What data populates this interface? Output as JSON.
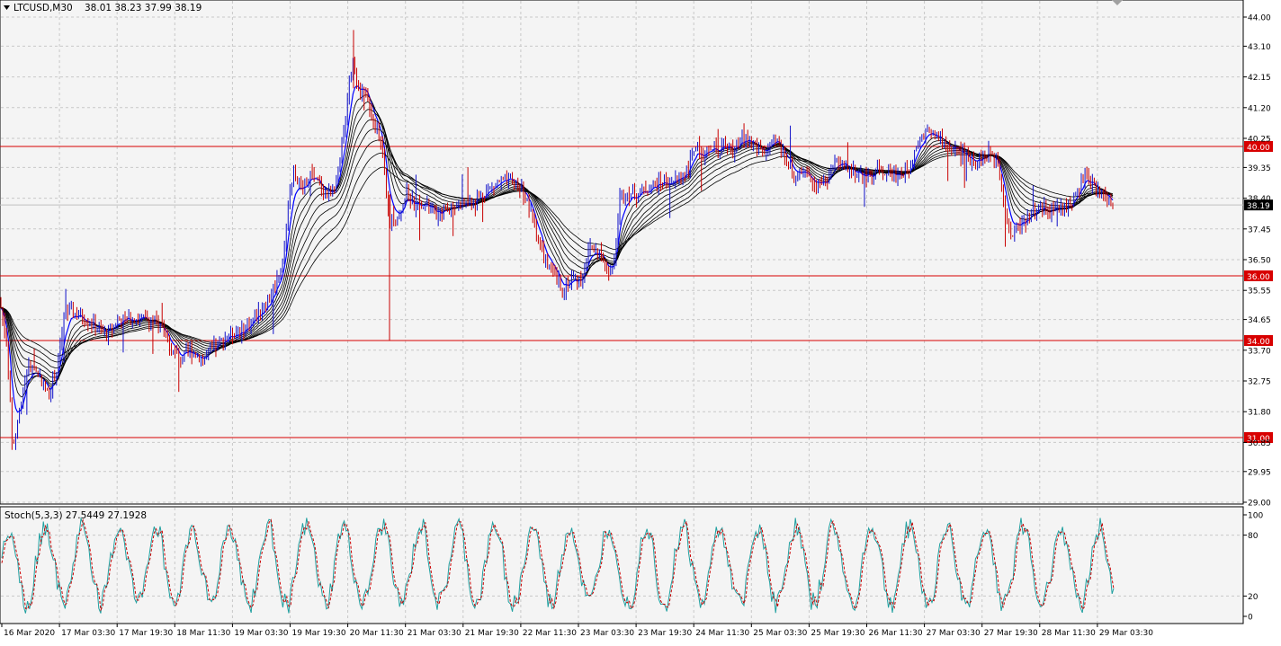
{
  "header": {
    "symbol": "LTCUSD,M30",
    "ohlc": "38.01 38.23 37.99 38.19"
  },
  "indicator": {
    "label": "Stoch(5,3,3) 27.5449 27.1928",
    "levels": [
      "100",
      "80",
      "20",
      "0"
    ]
  },
  "colors": {
    "background": "#f4f4f4",
    "grid": "#c8c8c8",
    "bull_candle": "#1010c8",
    "bear_candle": "#c80000",
    "ma_ribbon": "#000000",
    "fast_ma": "#0000ff",
    "hline": "#d80000",
    "stoch_main": "#20a0a0",
    "stoch_signal": "#c80000"
  },
  "chart_data": [
    {
      "type": "candlestick",
      "symbol": "LTCUSD",
      "timeframe": "M30",
      "current_price": "38.19",
      "ylim": [
        29.0,
        44.0
      ],
      "y_ticks": [
        "44.00",
        "43.10",
        "42.15",
        "41.20",
        "40.25",
        "39.35",
        "38.40",
        "37.45",
        "36.50",
        "35.55",
        "34.65",
        "33.70",
        "32.75",
        "31.80",
        "30.85",
        "29.95",
        "29.00"
      ],
      "horizontal_levels": [
        {
          "value": 40.0,
          "label": "40.00"
        },
        {
          "value": 36.0,
          "label": "36.00"
        },
        {
          "value": 34.0,
          "label": "34.00"
        },
        {
          "value": 31.0,
          "label": "31.00"
        }
      ],
      "x_ticks": [
        "16 Mar 2020",
        "17 Mar 03:30",
        "17 Mar 19:30",
        "18 Mar 11:30",
        "19 Mar 03:30",
        "19 Mar 19:30",
        "20 Mar 11:30",
        "21 Mar 03:30",
        "21 Mar 19:30",
        "22 Mar 11:30",
        "23 Mar 03:30",
        "23 Mar 19:30",
        "24 Mar 11:30",
        "25 Mar 03:30",
        "25 Mar 19:30",
        "26 Mar 11:30",
        "27 Mar 03:30",
        "27 Mar 19:30",
        "28 Mar 11:30",
        "29 Mar 03:30"
      ],
      "price_path": [
        [
          0,
          35.2
        ],
        [
          8,
          33.8
        ],
        [
          14,
          30.6
        ],
        [
          22,
          31.9
        ],
        [
          30,
          33.2
        ],
        [
          42,
          33.0
        ],
        [
          54,
          32.3
        ],
        [
          64,
          33.2
        ],
        [
          72,
          34.8
        ],
        [
          80,
          34.9
        ],
        [
          92,
          34.7
        ],
        [
          100,
          34.6
        ],
        [
          110,
          34.3
        ],
        [
          120,
          34.2
        ],
        [
          130,
          34.6
        ],
        [
          150,
          34.7
        ],
        [
          170,
          34.6
        ],
        [
          180,
          34.4
        ],
        [
          190,
          33.8
        ],
        [
          200,
          33.4
        ],
        [
          212,
          33.7
        ],
        [
          226,
          33.4
        ],
        [
          240,
          33.8
        ],
        [
          255,
          34.2
        ],
        [
          270,
          34.3
        ],
        [
          285,
          34.8
        ],
        [
          300,
          35.3
        ],
        [
          315,
          36.5
        ],
        [
          320,
          38.2
        ],
        [
          326,
          39.3
        ],
        [
          335,
          38.6
        ],
        [
          345,
          39.1
        ],
        [
          355,
          38.8
        ],
        [
          365,
          38.5
        ],
        [
          375,
          38.9
        ],
        [
          382,
          40.4
        ],
        [
          388,
          42.0
        ],
        [
          393,
          42.6
        ],
        [
          400,
          41.7
        ],
        [
          408,
          41.5
        ],
        [
          416,
          40.8
        ],
        [
          425,
          39.8
        ],
        [
          432,
          37.6
        ],
        [
          438,
          37.7
        ],
        [
          446,
          38.1
        ],
        [
          452,
          38.6
        ],
        [
          460,
          38.2
        ],
        [
          470,
          38.3
        ],
        [
          480,
          38.0
        ],
        [
          488,
          37.8
        ],
        [
          496,
          38.1
        ],
        [
          510,
          38.2
        ],
        [
          525,
          38.3
        ],
        [
          540,
          38.6
        ],
        [
          555,
          38.9
        ],
        [
          570,
          38.9
        ],
        [
          580,
          38.7
        ],
        [
          588,
          38.1
        ],
        [
          596,
          37.4
        ],
        [
          606,
          36.4
        ],
        [
          616,
          36.0
        ],
        [
          626,
          35.6
        ],
        [
          636,
          35.9
        ],
        [
          646,
          35.9
        ],
        [
          656,
          36.9
        ],
        [
          666,
          36.7
        ],
        [
          676,
          36.1
        ],
        [
          684,
          36.5
        ],
        [
          688,
          38.4
        ],
        [
          696,
          38.6
        ],
        [
          706,
          38.5
        ],
        [
          720,
          38.7
        ],
        [
          735,
          38.9
        ],
        [
          750,
          38.9
        ],
        [
          765,
          39.3
        ],
        [
          772,
          40.0
        ],
        [
          782,
          39.8
        ],
        [
          792,
          39.9
        ],
        [
          805,
          40.0
        ],
        [
          818,
          39.9
        ],
        [
          828,
          40.3
        ],
        [
          840,
          40.0
        ],
        [
          852,
          39.8
        ],
        [
          864,
          40.2
        ],
        [
          876,
          39.5
        ],
        [
          886,
          39.0
        ],
        [
          896,
          39.1
        ],
        [
          906,
          38.9
        ],
        [
          918,
          38.9
        ],
        [
          928,
          39.5
        ],
        [
          940,
          39.4
        ],
        [
          952,
          39.2
        ],
        [
          962,
          39.0
        ],
        [
          976,
          39.3
        ],
        [
          990,
          39.2
        ],
        [
          1000,
          39.1
        ],
        [
          1010,
          39.3
        ],
        [
          1020,
          40.2
        ],
        [
          1030,
          40.5
        ],
        [
          1042,
          40.3
        ],
        [
          1052,
          40.0
        ],
        [
          1062,
          39.9
        ],
        [
          1072,
          39.7
        ],
        [
          1080,
          39.6
        ],
        [
          1090,
          39.6
        ],
        [
          1100,
          39.8
        ],
        [
          1110,
          39.5
        ],
        [
          1118,
          38.0
        ],
        [
          1124,
          37.2
        ],
        [
          1132,
          37.6
        ],
        [
          1140,
          37.7
        ],
        [
          1150,
          38.0
        ],
        [
          1160,
          38.1
        ],
        [
          1170,
          38.0
        ],
        [
          1180,
          38.1
        ],
        [
          1190,
          38.2
        ],
        [
          1198,
          38.6
        ],
        [
          1206,
          39.1
        ],
        [
          1214,
          38.8
        ],
        [
          1222,
          38.6
        ],
        [
          1230,
          38.4
        ],
        [
          1238,
          38.19
        ]
      ],
      "stochastic": {
        "main": 27.5449,
        "signal": 27.1928,
        "ylim": [
          0,
          100
        ]
      }
    }
  ]
}
